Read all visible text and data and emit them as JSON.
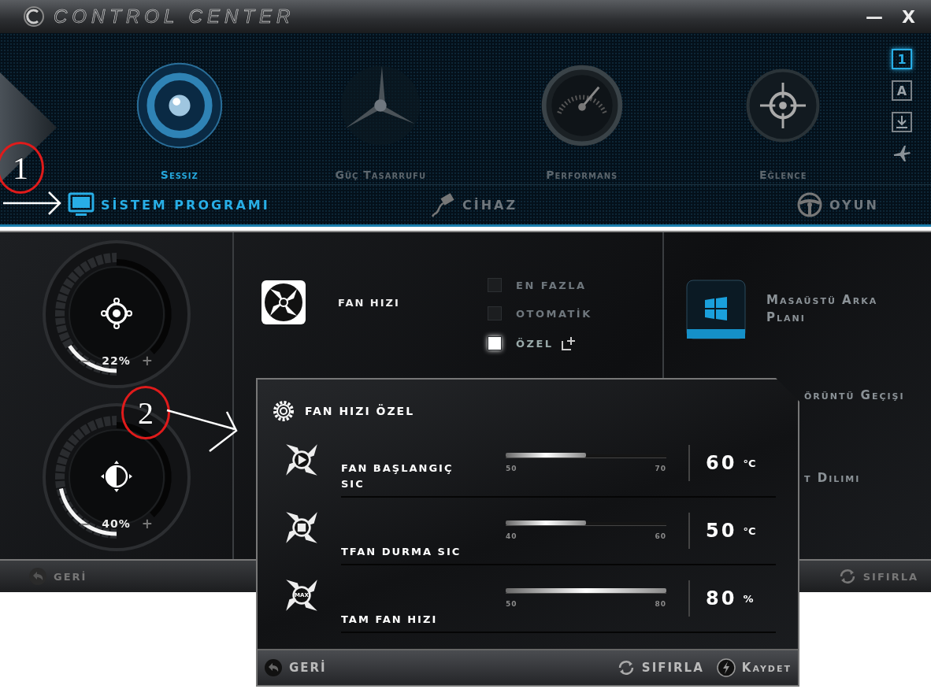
{
  "window": {
    "title": "CONTROL CENTER",
    "minimize": "—",
    "close": "X"
  },
  "modes": [
    {
      "label": "Sessiz",
      "kind": "disc",
      "selected": true
    },
    {
      "label": "Güç Tasarrufu",
      "kind": "propeller",
      "selected": false
    },
    {
      "label": "Performans",
      "kind": "gauge",
      "selected": false
    },
    {
      "label": "Eğlence",
      "kind": "crosshair",
      "selected": false
    }
  ],
  "side_buttons": [
    {
      "kind": "text",
      "label": "1",
      "selected": true
    },
    {
      "kind": "text",
      "label": "A",
      "selected": false
    },
    {
      "kind": "download",
      "selected": false
    },
    {
      "kind": "plane",
      "selected": false
    }
  ],
  "tabs": [
    {
      "label": "SİSTEM PROGRAMI",
      "kind": "monitor",
      "selected": true
    },
    {
      "label": "CİHAZ",
      "kind": "plug",
      "selected": false
    },
    {
      "label": "OYUN",
      "kind": "wheel",
      "selected": false
    }
  ],
  "dials": [
    {
      "kind": "volume",
      "level": 0.22,
      "reading": "22%",
      "decrease": "−",
      "increase": "+"
    },
    {
      "kind": "brightness",
      "level": 0.4,
      "reading": "40%",
      "decrease": "−",
      "increase": "+"
    }
  ],
  "fan": {
    "title": "FAN HIZI",
    "options": [
      {
        "label": "EN FAZLA",
        "selected": false
      },
      {
        "label": "OTOMATİK",
        "selected": false
      },
      {
        "label": "ÖZEL",
        "selected": true
      }
    ]
  },
  "right_items": [
    {
      "label": "Masaüstü Arka Planı"
    },
    {
      "label": "örüntü Geçişi"
    },
    {
      "label": "t Dilimi"
    }
  ],
  "footer": {
    "back": "GERİ",
    "reset": "SIFIRLA"
  },
  "popup": {
    "title": "FAN HIZI ÖZEL",
    "rows": [
      {
        "kind": "play",
        "label": "FAN BAŞLANGIÇ SIC",
        "level": 0.5,
        "min": "50",
        "max": "70",
        "value": "60",
        "unit": "°C"
      },
      {
        "kind": "stop",
        "label": "TFAN DURMA SIC",
        "level": 0.5,
        "min": "40",
        "max": "60",
        "value": "50",
        "unit": "°C"
      },
      {
        "kind": "max",
        "label": "TAM FAN HIZI",
        "badge": "MAX",
        "level": 1,
        "min": "50",
        "max": "80",
        "value": "80",
        "unit": "%"
      }
    ],
    "back": "GERİ",
    "reset": "SIFIRLA",
    "save": "Kaydet"
  },
  "annotations": [
    {
      "label": "1"
    },
    {
      "label": "2"
    }
  ]
}
